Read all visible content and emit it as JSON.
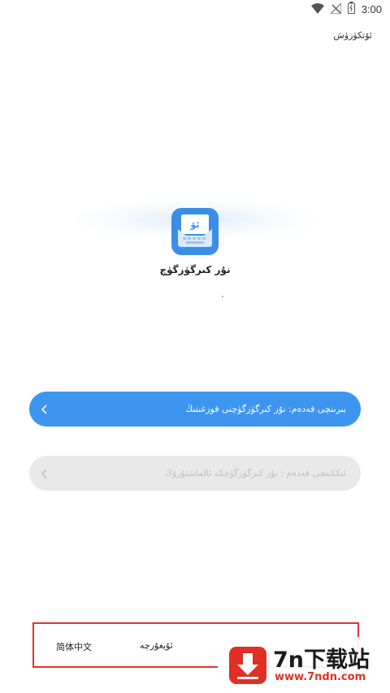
{
  "status_bar": {
    "time": "3:00",
    "icons": [
      "wifi-icon",
      "no-signal-icon",
      "battery-icon"
    ]
  },
  "header": {
    "skip_label": "ئۆتكۈزۈش"
  },
  "app": {
    "icon_letter": "ئۆ",
    "name": "نۇر كىرگۈزگۈچ",
    "icon_color": "#3a8ee6"
  },
  "steps": [
    {
      "label": "بىرىنچى قەدەم: نۇر كىرگۈزگۈچنى قوزغىتىڭ",
      "enabled": true,
      "icon": "chevron-left-icon"
    },
    {
      "label": "ئىككىنچى قەدەم : نۇر كىرگۈزگۈچكە ئالماشتۇرۇڭ",
      "enabled": false,
      "icon": "chevron-left-icon"
    }
  ],
  "languages": {
    "option_1": "简体中文",
    "option_2": "ئۇيغۇرچە"
  },
  "watermark": {
    "title": "7n下载站",
    "url": "www.7ndn.com"
  },
  "colors": {
    "primary": "#3d95f0",
    "disabled_bg": "#e9e9ea",
    "disabled_text": "#c1c1c4",
    "highlight_border": "#e23232",
    "watermark_red": "#e02f25"
  }
}
